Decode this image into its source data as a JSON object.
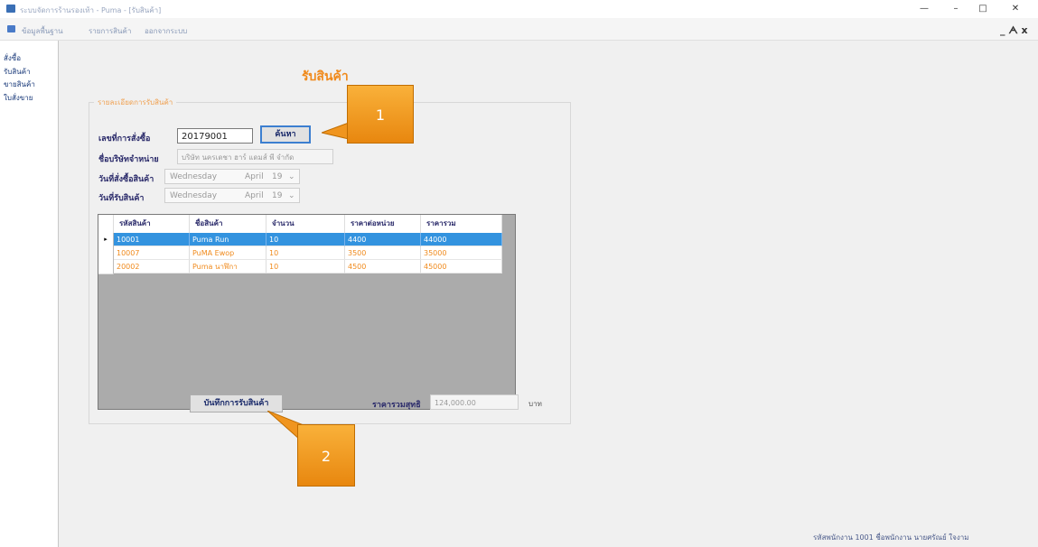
{
  "window": {
    "title": "ระบบจัดการร้านรองเท้า - Puma - [รับสินค้า]",
    "controls": [
      "—",
      "–",
      "□",
      "✕"
    ]
  },
  "menubar": {
    "items": [
      "ข้อมูลพื้นฐาน",
      "รายการสินค้า",
      "ออกจากระบบ"
    ],
    "mdi_controls": "_ ᗅ x"
  },
  "sidebar": {
    "items": [
      "สั่งซื้อ",
      "รับสินค้า",
      "ขายสินค้า",
      "ใบสั่งขาย"
    ]
  },
  "form": {
    "title": "รับสินค้า",
    "group_title": "รายละเอียดการรับสินค้า",
    "order_no_label": "เลขที่การสั่งซื้อ",
    "order_no_value": "20179001",
    "search_button": "ค้นหา",
    "supplier_label": "ชื่อบริษัทจำหน่าย",
    "supplier_value": "บริษัท นครเดชา ฮาร์ แดมส์ พี จำกัด",
    "order_date_label": "วันที่สั่งซื้อสินค้า",
    "order_date": {
      "day": "Wednesday",
      "month": "April",
      "date": "19"
    },
    "receive_date_label": "วันที่รับสินค้า",
    "receive_date": {
      "day": "Wednesday",
      "month": "April",
      "date": "19"
    },
    "save_button": "บันทึกการรับสินค้า",
    "total_label": "ราคารวมสุทธิ",
    "total_value": "124,000.00",
    "total_unit": "บาท"
  },
  "grid": {
    "columns": [
      "รหัสสินค้า",
      "ชื่อสินค้า",
      "จำนวน",
      "ราคาต่อหน่วย",
      "ราคารวม"
    ],
    "rows": [
      {
        "code": "10001",
        "name": "Puma Run",
        "qty": "10",
        "unit_price": "4400",
        "total": "44000",
        "selected": true
      },
      {
        "code": "10007",
        "name": "PuMA Ewop",
        "qty": "10",
        "unit_price": "3500",
        "total": "35000",
        "selected": false
      },
      {
        "code": "20002",
        "name": "Puma นาฬิกา",
        "qty": "10",
        "unit_price": "4500",
        "total": "45000",
        "selected": false
      }
    ],
    "current_row_marker": "▸"
  },
  "callouts": [
    "1",
    "2"
  ],
  "statusbar": {
    "text": "รหัสพนักงาน 1001  ชื่อพนักงาน นายศรัณย์ ใจงาม"
  },
  "colors": {
    "accent_orange": "#f08a1c",
    "selection_blue": "#3393df",
    "callout_orange": "#f5a02a"
  }
}
